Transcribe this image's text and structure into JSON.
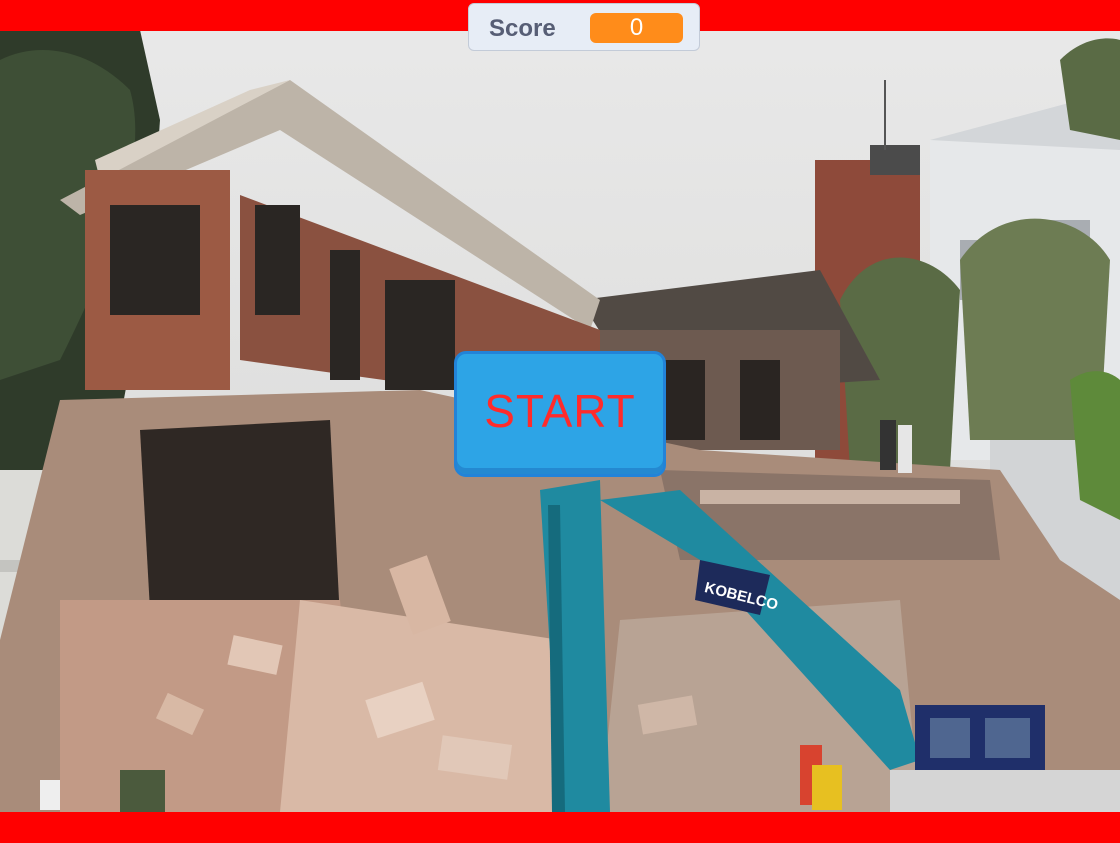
{
  "game": {
    "score_label": "Score",
    "score_value": "0",
    "start_label": "START",
    "excavator_brand": "KOBELCO"
  },
  "colors": {
    "frame_bars": "#ff0000",
    "monitor_bg": "#e7edf6",
    "monitor_value_bg": "#ff8c1a",
    "start_button_bg": "#2da4e6",
    "start_text": "#ff2b2b"
  },
  "scene": {
    "backdrop": "building-demolition-photo"
  }
}
